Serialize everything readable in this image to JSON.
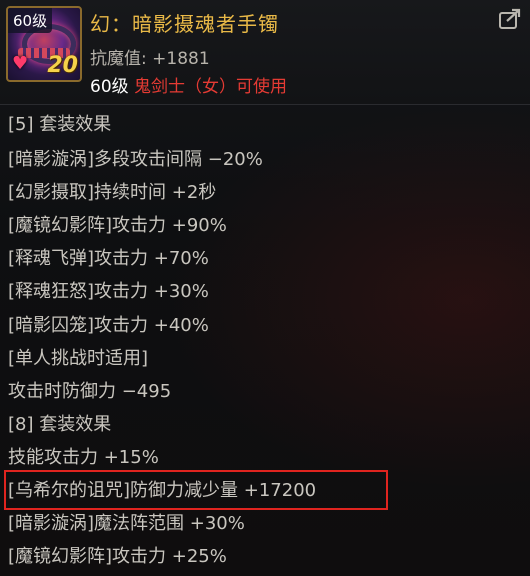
{
  "header": {
    "level_badge": "60级",
    "enhance_level": "20",
    "title": "幻：暗影摄魂者手镯",
    "stat": "抗魔值: +1881",
    "req_level": "60级 ",
    "req_class": "鬼剑士（女）可使用"
  },
  "lines": [
    "[5] 套装效果",
    "[暗影漩涡]多段攻击间隔 −20%",
    "[幻影摄取]持续时间 +2秒",
    "[魔镜幻影阵]攻击力 +90%",
    "[释魂飞弹]攻击力 +70%",
    "[释魂狂怒]攻击力 +30%",
    "[暗影囚笼]攻击力 +40%",
    "[单人挑战时适用]",
    "攻击时防御力 −495",
    "[8] 套装效果",
    "技能攻击力 +15%",
    "[乌希尔的诅咒]防御力减少量 +17200",
    "[暗影漩涡]魔法阵范围 +30%",
    "[魔镜幻影阵]攻击力 +25%"
  ],
  "colors": {
    "title": "#e9b947",
    "class_requirement": "#e53b34",
    "highlight_box": "#e0241f"
  }
}
